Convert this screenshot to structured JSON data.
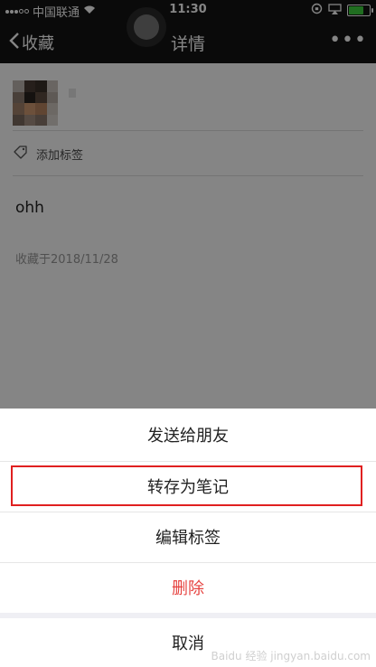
{
  "status_bar": {
    "carrier": "中国联通",
    "time": "11:30"
  },
  "nav": {
    "back_label": "收藏",
    "title": "详情"
  },
  "detail": {
    "tag_label": "添加标签",
    "text": "ohh",
    "favorited_time": "收藏于2018/11/28"
  },
  "action_sheet": {
    "items": [
      {
        "label": "发送给朋友"
      },
      {
        "label": "转存为笔记"
      },
      {
        "label": "编辑标签"
      },
      {
        "label": "删除"
      },
      {
        "label": "取消"
      }
    ]
  },
  "colors": {
    "highlight_border": "#e02020",
    "delete_text": "#e64340",
    "battery": "#3fd13f"
  },
  "watermark": "Baidu 经验 jingyan.baidu.com"
}
